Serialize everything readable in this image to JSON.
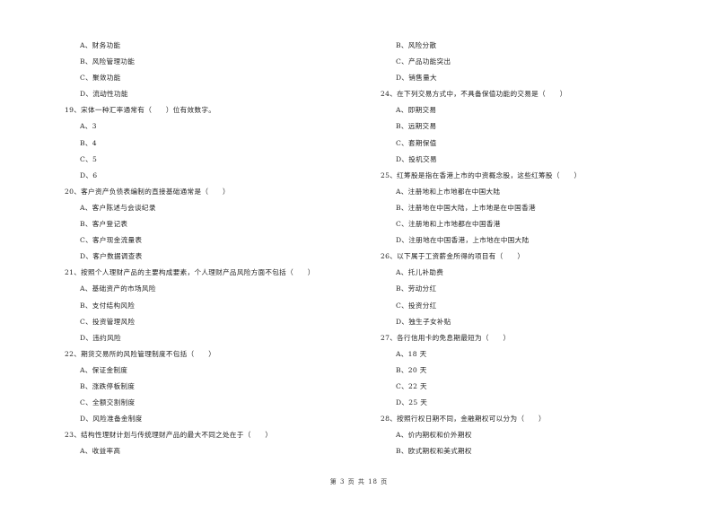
{
  "left_column": [
    {
      "type": "option",
      "text": "A、财务功能"
    },
    {
      "type": "option",
      "text": "B、风险管理功能"
    },
    {
      "type": "option",
      "text": "C、聚敛功能"
    },
    {
      "type": "option",
      "text": "D、流动性功能"
    },
    {
      "type": "question",
      "text": "19、宋体一种汇率通常有（　　）位有效数字。"
    },
    {
      "type": "option",
      "text": "A、3"
    },
    {
      "type": "option",
      "text": "B、4"
    },
    {
      "type": "option",
      "text": "C、5"
    },
    {
      "type": "option",
      "text": "D、6"
    },
    {
      "type": "question",
      "text": "20、客户资产负债表编制的直接基础通常是（　　）"
    },
    {
      "type": "option",
      "text": "A、客户陈述与会谈纪录"
    },
    {
      "type": "option",
      "text": "B、客户登记表"
    },
    {
      "type": "option",
      "text": "C、客户现金流量表"
    },
    {
      "type": "option",
      "text": "D、客户数据调查表"
    },
    {
      "type": "question",
      "text": "21、按照个人理财产品的主要构成要素，个人理财产品风险方面不包括（　　）"
    },
    {
      "type": "option",
      "text": "A、基础资产的市场风险"
    },
    {
      "type": "option",
      "text": "B、支付结构风险"
    },
    {
      "type": "option",
      "text": "C、投资管理风险"
    },
    {
      "type": "option",
      "text": "D、违约风险"
    },
    {
      "type": "question",
      "text": "22、期货交易所的风险管理制度不包括（　　）"
    },
    {
      "type": "option",
      "text": "A、保证金制度"
    },
    {
      "type": "option",
      "text": "B、涨跌停板制度"
    },
    {
      "type": "option",
      "text": "C、全额交割制度"
    },
    {
      "type": "option",
      "text": "D、风险准备金制度"
    },
    {
      "type": "question",
      "text": "23、结构性理财计划与传统理财产品的最大不同之处在于（　　）"
    },
    {
      "type": "option",
      "text": "A、收益率高"
    }
  ],
  "right_column": [
    {
      "type": "option",
      "text": "B、风险分散"
    },
    {
      "type": "option",
      "text": "C、产品功能突出"
    },
    {
      "type": "option",
      "text": "D、销售量大"
    },
    {
      "type": "question",
      "text": "24、在下列交易方式中，不具备保值功能的交易是（　　）"
    },
    {
      "type": "option",
      "text": "A、即期交易"
    },
    {
      "type": "option",
      "text": "B、远期交易"
    },
    {
      "type": "option",
      "text": "C、套期保值"
    },
    {
      "type": "option",
      "text": "D、投机交易"
    },
    {
      "type": "question",
      "text": "25、红筹股是指在香港上市的中资概念股，这些红筹股（　　）"
    },
    {
      "type": "option",
      "text": "A、注册地和上市地都在中国大陆"
    },
    {
      "type": "option",
      "text": "B、注册地在中国大陆，上市地是在中国香港"
    },
    {
      "type": "option",
      "text": "C、注册地和上市地都在中国香港"
    },
    {
      "type": "option",
      "text": "D、注册地在中国香港，上市地在中国大陆"
    },
    {
      "type": "question",
      "text": "26、以下属于工资薪金所得的项目有（　　）"
    },
    {
      "type": "option",
      "text": "A、托儿补助费"
    },
    {
      "type": "option",
      "text": "B、劳动分红"
    },
    {
      "type": "option",
      "text": "C、投资分红"
    },
    {
      "type": "option",
      "text": "D、独生子女补贴"
    },
    {
      "type": "question",
      "text": "27、各行信用卡的免息期最短为（　　）"
    },
    {
      "type": "option",
      "text": "A、18 天"
    },
    {
      "type": "option",
      "text": "B、20 天"
    },
    {
      "type": "option",
      "text": "C、22 天"
    },
    {
      "type": "option",
      "text": "D、25 天"
    },
    {
      "type": "question",
      "text": "28、按照行权日期不同，金融期权可以分为（　　）"
    },
    {
      "type": "option",
      "text": "A、价内期权和价外期权"
    },
    {
      "type": "option",
      "text": "B、欧式期权和美式期权"
    }
  ],
  "footer": {
    "page_label": "第 3 页 共 18 页"
  }
}
